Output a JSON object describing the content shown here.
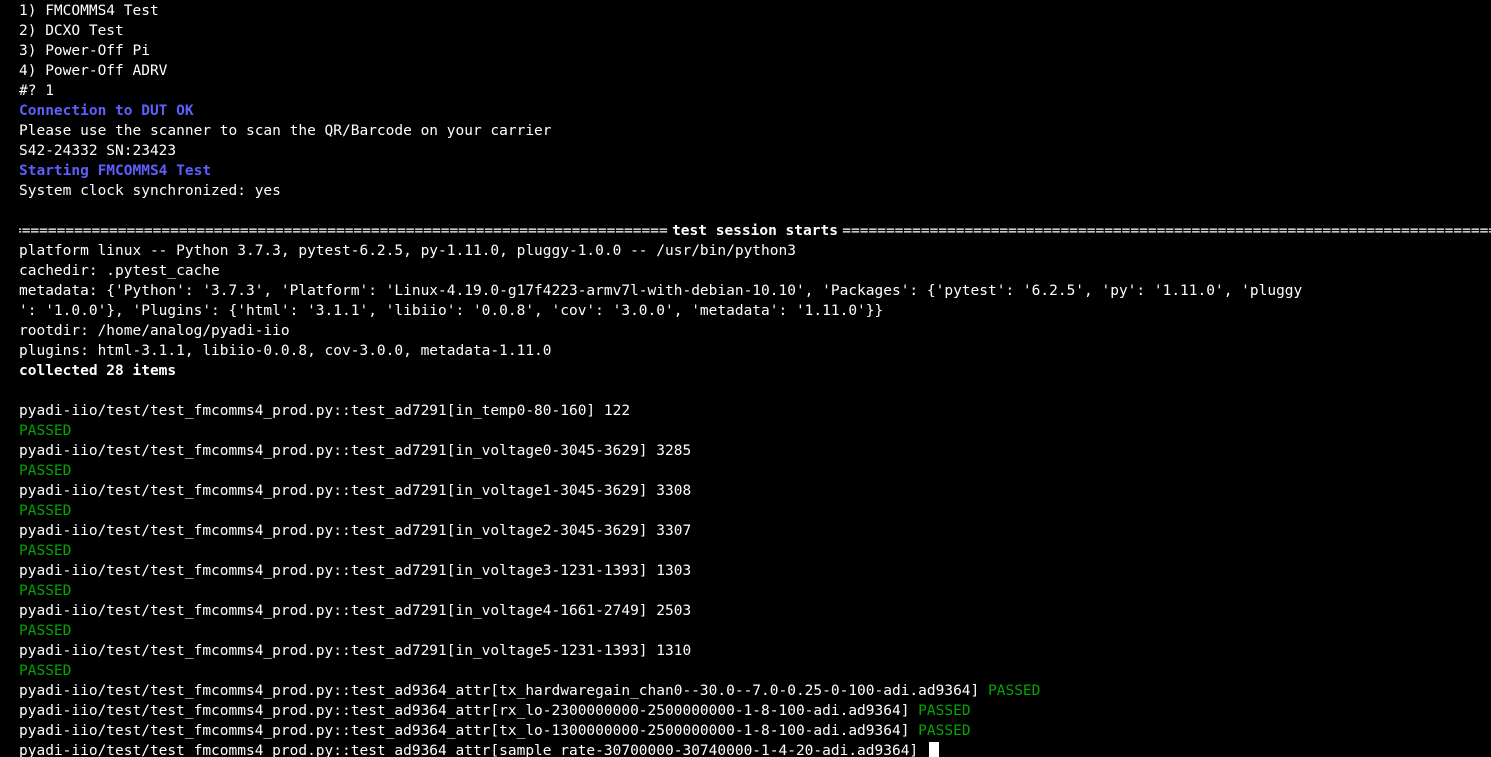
{
  "menu": {
    "items": [
      "1) FMCOMMS4 Test",
      "2) DCXO Test",
      "3) Power-Off Pi",
      "4) Power-Off ADRV"
    ],
    "prompt": "#? 1"
  },
  "messages": {
    "connection": "Connection to DUT OK",
    "scan_instruction": "Please use the scanner to scan the QR/Barcode on your carrier",
    "serial": "S42-24332 SN:23423",
    "starting": "Starting FMCOMMS4 Test",
    "clock": "System clock synchronized: yes"
  },
  "session": {
    "separator_title": "test session starts",
    "platform": "platform linux -- Python 3.7.3, pytest-6.2.5, py-1.11.0, pluggy-1.0.0 -- /usr/bin/python3",
    "cachedir": "cachedir: .pytest_cache",
    "metadata_line1": "metadata: {'Python': '3.7.3', 'Platform': 'Linux-4.19.0-g17f4223-armv7l-with-debian-10.10', 'Packages': {'pytest': '6.2.5', 'py': '1.11.0', 'pluggy",
    "metadata_line2": "': '1.0.0'}, 'Plugins': {'html': '3.1.1', 'libiio': '0.0.8', 'cov': '3.0.0', 'metadata': '1.11.0'}}",
    "rootdir": "rootdir: /home/analog/pyadi-iio",
    "plugins": "plugins: html-3.1.1, libiio-0.0.8, cov-3.0.0, metadata-1.11.0",
    "collected": "collected 28 items"
  },
  "tests": [
    {
      "name": "pyadi-iio/test/test_fmcomms4_prod.py::test_ad7291[in_temp0-80-160] 122",
      "status": "PASSED"
    },
    {
      "name": "pyadi-iio/test/test_fmcomms4_prod.py::test_ad7291[in_voltage0-3045-3629] 3285",
      "status": "PASSED"
    },
    {
      "name": "pyadi-iio/test/test_fmcomms4_prod.py::test_ad7291[in_voltage1-3045-3629] 3308",
      "status": "PASSED"
    },
    {
      "name": "pyadi-iio/test/test_fmcomms4_prod.py::test_ad7291[in_voltage2-3045-3629] 3307",
      "status": "PASSED"
    },
    {
      "name": "pyadi-iio/test/test_fmcomms4_prod.py::test_ad7291[in_voltage3-1231-1393] 1303",
      "status": "PASSED"
    },
    {
      "name": "pyadi-iio/test/test_fmcomms4_prod.py::test_ad7291[in_voltage4-1661-2749] 2503",
      "status": "PASSED"
    },
    {
      "name": "pyadi-iio/test/test_fmcomms4_prod.py::test_ad7291[in_voltage5-1231-1393] 1310",
      "status": "PASSED"
    }
  ],
  "inline_tests": [
    {
      "name": "pyadi-iio/test/test_fmcomms4_prod.py::test_ad9364_attr[tx_hardwaregain_chan0--30.0--7.0-0.25-0-100-adi.ad9364] ",
      "status": "PASSED"
    },
    {
      "name": "pyadi-iio/test/test_fmcomms4_prod.py::test_ad9364_attr[rx_lo-2300000000-2500000000-1-8-100-adi.ad9364] ",
      "status": "PASSED"
    },
    {
      "name": "pyadi-iio/test/test_fmcomms4_prod.py::test_ad9364_attr[tx_lo-1300000000-2500000000-1-8-100-adi.ad9364] ",
      "status": "PASSED"
    }
  ],
  "current_test": "pyadi-iio/test/test_fmcomms4_prod.py::test_ad9364_attr[sample_rate-30700000-30740000-1-4-20-adi.ad9364] ",
  "colors": {
    "background": "#000000",
    "foreground": "#ffffff",
    "highlight_blue": "#5f5fff",
    "passed_green": "#00a800"
  }
}
